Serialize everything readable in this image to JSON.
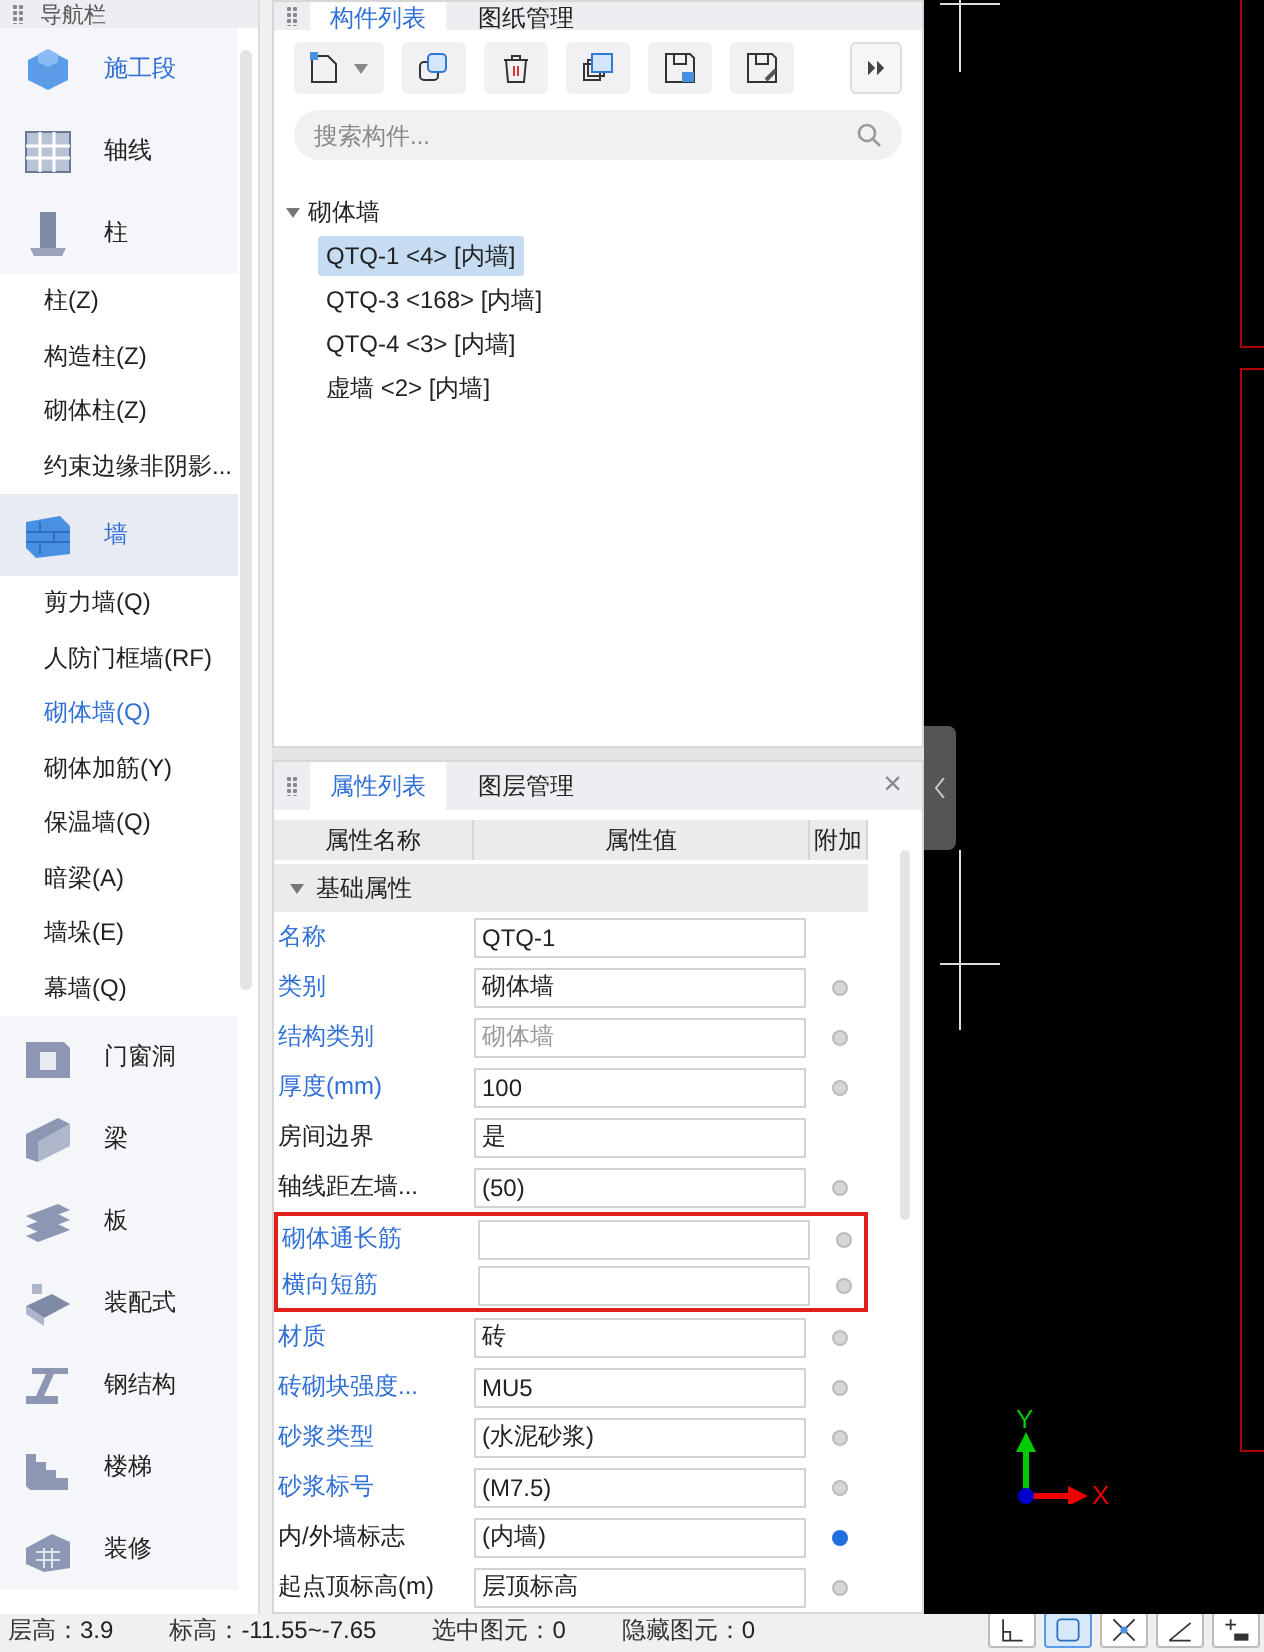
{
  "navigator": {
    "title": "导航栏",
    "items": [
      {
        "label": "施工段",
        "selected": false,
        "accent": true
      },
      {
        "label": "轴线",
        "selected": false,
        "accent": false
      },
      {
        "label": "柱",
        "selected": false,
        "accent": false,
        "children": [
          {
            "label": "柱(Z)",
            "selected": false
          },
          {
            "label": "构造柱(Z)",
            "selected": false
          },
          {
            "label": "砌体柱(Z)",
            "selected": false
          },
          {
            "label": "约束边缘非阴影...",
            "selected": false
          }
        ]
      },
      {
        "label": "墙",
        "selected": true,
        "accent": false,
        "children": [
          {
            "label": "剪力墙(Q)",
            "selected": false
          },
          {
            "label": "人防门框墙(RF)",
            "selected": false
          },
          {
            "label": "砌体墙(Q)",
            "selected": true
          },
          {
            "label": "砌体加筋(Y)",
            "selected": false
          },
          {
            "label": "保温墙(Q)",
            "selected": false
          },
          {
            "label": "暗梁(A)",
            "selected": false
          },
          {
            "label": "墙垛(E)",
            "selected": false
          },
          {
            "label": "幕墙(Q)",
            "selected": false
          }
        ]
      },
      {
        "label": "门窗洞",
        "selected": false,
        "accent": false
      },
      {
        "label": "梁",
        "selected": false,
        "accent": false
      },
      {
        "label": "板",
        "selected": false,
        "accent": false
      },
      {
        "label": "装配式",
        "selected": false,
        "accent": false
      },
      {
        "label": "钢结构",
        "selected": false,
        "accent": false
      },
      {
        "label": "楼梯",
        "selected": false,
        "accent": false
      },
      {
        "label": "装修",
        "selected": false,
        "accent": false
      }
    ]
  },
  "component_panel": {
    "tabs": [
      {
        "label": "构件列表",
        "selected": true
      },
      {
        "label": "图纸管理",
        "selected": false
      }
    ],
    "search": {
      "placeholder": "搜索构件..."
    },
    "tree": {
      "label": "砌体墙",
      "expanded": true,
      "children": [
        {
          "label": "QTQ-1 <4> [内墙]",
          "selected": true
        },
        {
          "label": "QTQ-3 <168> [内墙]",
          "selected": false
        },
        {
          "label": "QTQ-4 <3> [内墙]",
          "selected": false
        },
        {
          "label": "虚墙 <2> [内墙]",
          "selected": false
        }
      ]
    }
  },
  "property_panel": {
    "tabs": [
      {
        "label": "属性列表",
        "selected": true
      },
      {
        "label": "图层管理",
        "selected": false
      }
    ],
    "close": "×",
    "columns": [
      "属性名称",
      "属性值",
      "附加"
    ],
    "group": {
      "label": "基础属性",
      "expanded": true
    },
    "rows": [
      {
        "name": "名称",
        "value": "QTQ-1",
        "public": true,
        "readonly": false,
        "flagged": false
      },
      {
        "name": "类别",
        "value": "砌体墙",
        "public": true,
        "readonly": false,
        "addon": false,
        "flagged": false
      },
      {
        "name": "结构类别",
        "value": "砌体墙",
        "public": true,
        "readonly": true,
        "addon": false,
        "flagged": false
      },
      {
        "name": "厚度(mm)",
        "value": "100",
        "public": true,
        "readonly": false,
        "addon": false,
        "flagged": false
      },
      {
        "name": "房间边界",
        "value": "是",
        "public": false,
        "readonly": false,
        "flagged": false
      },
      {
        "name": "轴线距左墙...",
        "value": "(50)",
        "public": false,
        "readonly": false,
        "addon": false,
        "flagged": false
      },
      {
        "name": "砌体通长筋",
        "value": "",
        "public": true,
        "readonly": false,
        "addon": false,
        "flagged": true
      },
      {
        "name": "横向短筋",
        "value": "",
        "public": true,
        "readonly": false,
        "addon": false,
        "flagged": true
      },
      {
        "name": "材质",
        "value": "砖",
        "public": true,
        "readonly": false,
        "addon": false,
        "flagged": false
      },
      {
        "name": "砖砌块强度...",
        "value": "MU5",
        "public": true,
        "readonly": false,
        "addon": false,
        "flagged": false
      },
      {
        "name": "砂浆类型",
        "value": "(水泥砂浆)",
        "public": true,
        "readonly": false,
        "addon": false,
        "flagged": false
      },
      {
        "name": "砂浆标号",
        "value": "(M7.5)",
        "public": true,
        "readonly": false,
        "addon": false,
        "flagged": false
      },
      {
        "name": "内/外墙标志",
        "value": "(内墙)",
        "public": false,
        "readonly": false,
        "addon": true,
        "flagged": false
      },
      {
        "name": "起点顶标高(m)",
        "value": "层顶标高",
        "public": false,
        "readonly": false,
        "addon": false,
        "flagged": false
      }
    ]
  },
  "canvas": {
    "axis": {
      "x": "X",
      "y": "Y"
    }
  },
  "status_bar": {
    "fields": [
      {
        "label": "层高：",
        "value": "3.9"
      },
      {
        "label": "标高：",
        "value": "-11.55~-7.65"
      },
      {
        "label": "选中图元：",
        "value": "0"
      },
      {
        "label": "隐藏图元：",
        "value": "0"
      }
    ],
    "tools": [
      {
        "selected": false
      },
      {
        "selected": true
      },
      {
        "selected": false
      },
      {
        "selected": false
      },
      {
        "selected": false
      }
    ]
  }
}
